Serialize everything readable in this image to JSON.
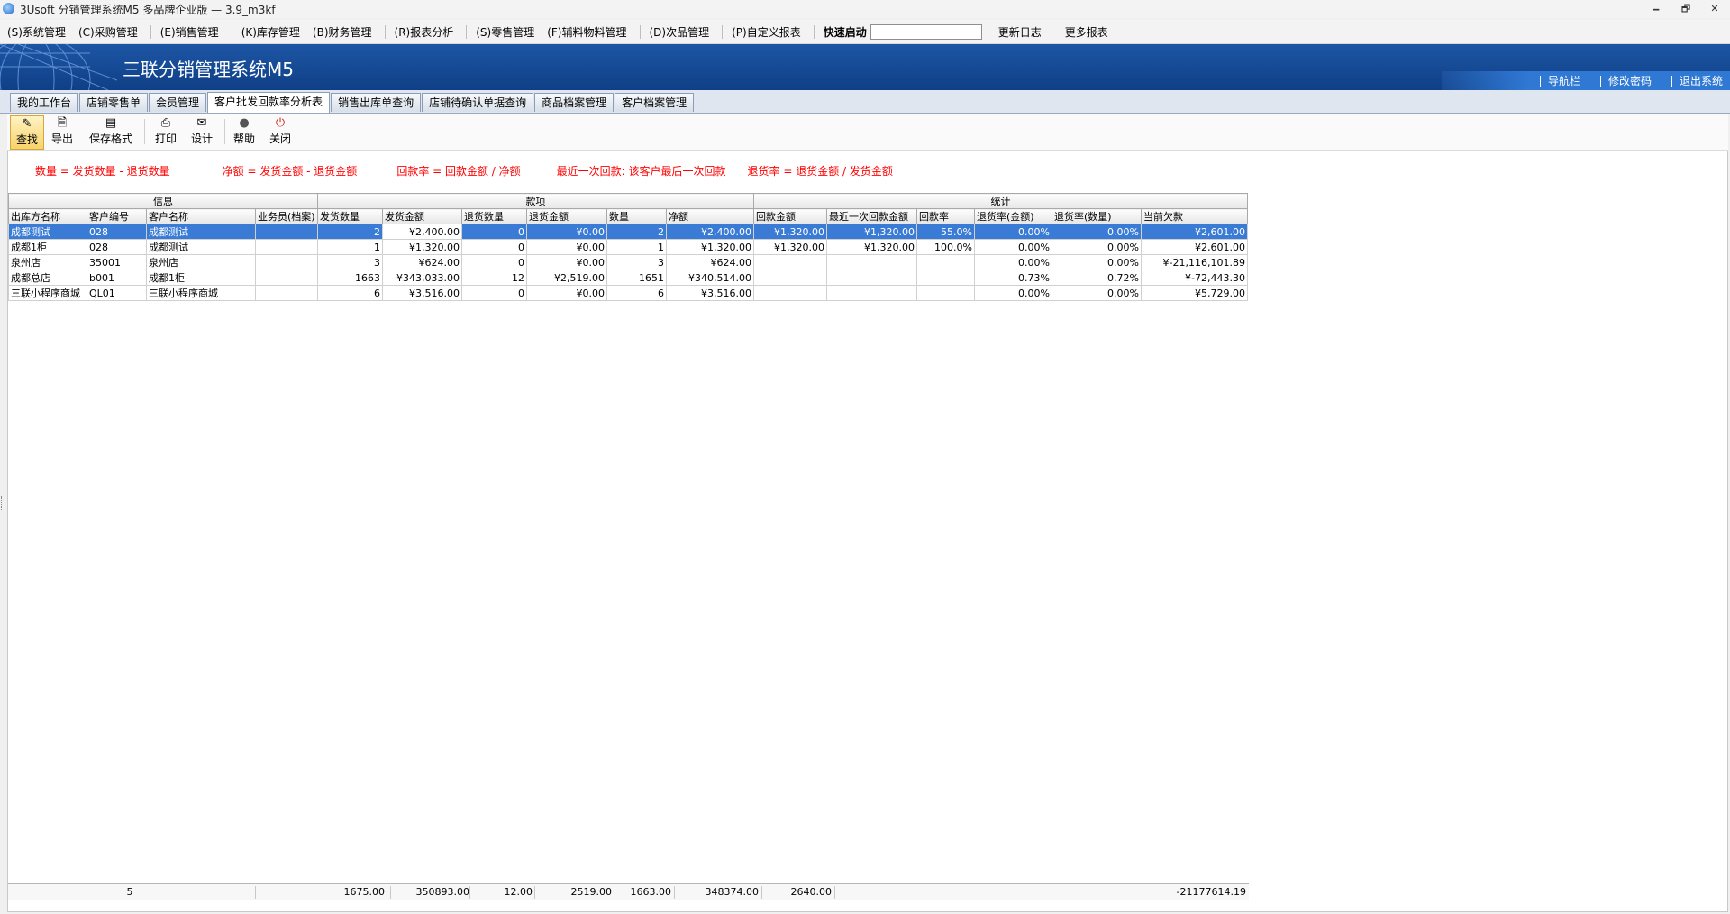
{
  "window": {
    "title": "3Usoft 分销管理系统M5 多品牌企业版 — 3.9_m3kf",
    "minimize_glyph": "🗕",
    "restore_glyph": "🗗",
    "close_glyph": "✕"
  },
  "menu": {
    "items": [
      "(S)系统管理",
      "(C)采购管理",
      "(E)销售管理",
      "(K)库存管理",
      "(B)财务管理",
      "(R)报表分析",
      "(S)零售管理",
      "(F)辅料物料管理",
      "(D)次品管理",
      "(P)自定义报表"
    ],
    "quick_label": "快速启动",
    "quick_value": "",
    "extras": [
      "更新日志",
      "更多报表"
    ]
  },
  "banner": {
    "title": "三联分销管理系统M5",
    "links": [
      "导航栏",
      "修改密码",
      "退出系统"
    ]
  },
  "tabs": [
    {
      "label": "我的工作台",
      "active": false
    },
    {
      "label": "店铺零售单",
      "active": false
    },
    {
      "label": "会员管理",
      "active": false
    },
    {
      "label": "客户批发回款率分析表",
      "active": true
    },
    {
      "label": "销售出库单查询",
      "active": false
    },
    {
      "label": "店铺待确认单据查询",
      "active": false
    },
    {
      "label": "商品档案管理",
      "active": false
    },
    {
      "label": "客户档案管理",
      "active": false
    }
  ],
  "toolbar": {
    "query": "查找",
    "export": "导出",
    "save_format": "保存格式",
    "print": "打印",
    "design": "设计",
    "help": "帮助",
    "close": "关闭",
    "icons": {
      "query": "magnifier-icon",
      "export": "export-icon",
      "save_format": "save-icon",
      "print": "printer-icon",
      "design": "envelope-icon",
      "help": "help-icon",
      "close": "power-icon"
    }
  },
  "formulas": [
    "数量 = 发货数量 - 退货数量",
    "净额 = 发货金额 - 退货金额",
    "回款率 = 回款金额 / 净额",
    "最近一次回款: 该客户最后一次回款",
    "退货率 = 退货金额 / 发货金额"
  ],
  "grid": {
    "groups": [
      {
        "label": "信息",
        "span": 4
      },
      {
        "label": "款项",
        "span": 6
      },
      {
        "label": "统计",
        "span": 6
      }
    ],
    "columns": [
      "出库方名称",
      "客户编号",
      "客户名称",
      "业务员(档案)",
      "发货数量",
      "发货金额",
      "退货数量",
      "退货金额",
      "数量",
      "净额",
      "回款金额",
      "最近一次回款金额",
      "回款率",
      "退货率(金额)",
      "退货率(数量)",
      "当前欠款"
    ],
    "rows": [
      [
        "成都测试",
        "028",
        "成都测试",
        "",
        "2",
        "¥2,400.00",
        "0",
        "¥0.00",
        "2",
        "¥2,400.00",
        "¥1,320.00",
        "¥1,320.00",
        "55.0%",
        "0.00%",
        "0.00%",
        "¥2,601.00"
      ],
      [
        "成都1柜",
        "028",
        "成都测试",
        "",
        "1",
        "¥1,320.00",
        "0",
        "¥0.00",
        "1",
        "¥1,320.00",
        "¥1,320.00",
        "¥1,320.00",
        "100.0%",
        "0.00%",
        "0.00%",
        "¥2,601.00"
      ],
      [
        "泉州店",
        "35001",
        "泉州店",
        "",
        "3",
        "¥624.00",
        "0",
        "¥0.00",
        "3",
        "¥624.00",
        "",
        "",
        "",
        "0.00%",
        "0.00%",
        "¥-21,116,101.89"
      ],
      [
        "成都总店",
        "b001",
        "成都1柜",
        "",
        "1663",
        "¥343,033.00",
        "12",
        "¥2,519.00",
        "1651",
        "¥340,514.00",
        "",
        "",
        "",
        "0.73%",
        "0.72%",
        "¥-72,443.30"
      ],
      [
        "三联小程序商城",
        "QL01",
        "三联小程序商城",
        "",
        "6",
        "¥3,516.00",
        "0",
        "¥0.00",
        "6",
        "¥3,516.00",
        "",
        "",
        "",
        "0.00%",
        "0.00%",
        "¥5,729.00"
      ]
    ],
    "selected_row": 0
  },
  "footer": {
    "count": "5",
    "ship_qty": "1675.00",
    "ship_amount": "350893.00",
    "return_qty": "12.00",
    "return_amount": "2519.00",
    "qty": "1663.00",
    "net": "348374.00",
    "payback": "2640.00",
    "debt": "-21177614.19"
  }
}
